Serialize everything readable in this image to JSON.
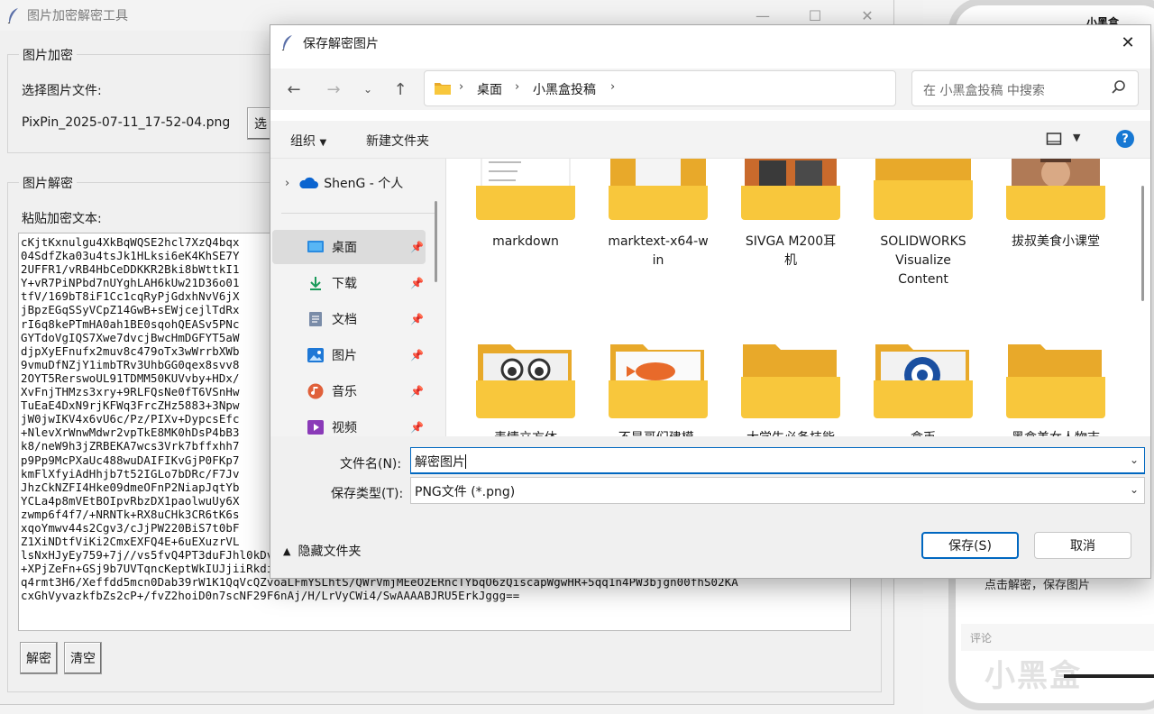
{
  "app": {
    "title": "图片加密解密工具",
    "encrypt_group": "图片加密",
    "choose_file_label": "选择图片文件:",
    "file_name": "PixPin_2025-07-11_17-52-04.png",
    "choose_button": "选",
    "decrypt_group": "图片解密",
    "paste_label": "粘贴加密文本:",
    "cipher_lines": [
      "cKjtKxnulgu4XkBqWQSE2hcl7XzQ4bqx",
      "04SdfZka03u4tsJk1HLksi6eK4KhSE7Y",
      "2UFFR1/vRB4HbCeDDKKR2Bki8bWttkI1",
      "Y+vR7PiNPbd7nUYghLAH6kUw21D36o01",
      "tfV/169bT8iF1Cc1cqRyPjGdxhNvV6jX",
      "jBpzEGqSSyVCpZ14GwB+sEWjcejlTdRx",
      "rI6q8kePTmHA0ah1BE0sqohQEASv5PNc",
      "GYTdoVgIQS7Xwe7dvcjBwcHmDGFYT5aW",
      "djpXyEFnufx2muv8c479oTx3wWrrbXWb",
      "9vmuDfNZjY1imbTRv3UhbGG0qex8svv8",
      "2OYT5RerswoUL91TDMM50KUVvby+HDx/",
      "XvFnjTHMzs3xry+9RLFQsNe0fT6VSnHw",
      "TuEaE4DxN9rjKFWq3FrcZHz5883+3Npw",
      "jW0jwIKV4x6vU6c/Pz/PIXv+DypcsEfc",
      "+NlevXrWnwMdwr2vpTkE8MK0hDsP4bB3",
      "k8/neW9h3jZRBEKA7wcs3Vrk7bffxhh7",
      "p9Pp9McPXaUc488wuDAIFIKvGjP0FKp7",
      "kmFlXfyiAdHhjb7t52IGLo7bDRc/F7Jv",
      "JhzCkNZFI4Hke09dmeOFnP2NiapJqtYb",
      "YCLa4p8mVEtBOIpvRbzDX1paolwuUy6X",
      "zwmp6f4f7/+NRNTk+RX8uCHk3CR6tK6s",
      "xqoYmwv44s2Cgv3/cJjPW220BiS7t0bF",
      "Z1XiNDtfViKi2CmxEXFQ4E+6uEXuzrVL",
      "lsNxHJyEy759+7j//vs5fvQ4PT3duFJhl0kDvnkEzwlOSOVjHhnClWqSyC+CKHh3jdwEmpniVBC6SLLNK5fzzaNjVzOi7yrjq+OCSLEhw",
      "+XPjZeFn+GSj9b7UVTqncKeptWkIUJjiiRkdiTEuOfF/ta2hHYtZjWaBWhEM8WecxMufX19HDx4kAfPPMjYqN2YIqjXLb/WUbnrCieC67",
      "q4rmt3H6/Xeffdd5mcn0Dab39rW1K1QqVcQZvoaLFmYSLhtS/QWrVmjMEeO2ERncTYbqO6zQiscapWgwHR+5qq1n4PW3bjgn00fhS02KA",
      "cxGhVyvazkfbZs2cP+/fvZ2hoiD0n7scNF29F6nAj/H/LrVyCWi4/SwAAAABJRU5ErkJggg=="
    ],
    "decrypt_button": "解密",
    "clear_button": "清空"
  },
  "background_app": {
    "logo_text": "小黑盒",
    "text_line": "点击解密，保存图片",
    "comment_placeholder": "评论",
    "watermark": "小黑盒"
  },
  "dialog": {
    "title": "保存解密图片",
    "breadcrumbs": [
      "桌面",
      "小黑盒投稿"
    ],
    "search_placeholder": "在 小黑盒投稿 中搜索",
    "organize_label": "组织",
    "new_folder_label": "新建文件夹",
    "help_label": "?",
    "nav": {
      "onedrive": "ShenG - 个人",
      "items": [
        {
          "label": "桌面",
          "icon": "desktop-icon",
          "selected": true
        },
        {
          "label": "下载",
          "icon": "download-icon",
          "selected": false
        },
        {
          "label": "文档",
          "icon": "document-icon",
          "selected": false
        },
        {
          "label": "图片",
          "icon": "pictures-icon",
          "selected": false
        },
        {
          "label": "音乐",
          "icon": "music-icon",
          "selected": false
        },
        {
          "label": "视频",
          "icon": "video-icon",
          "selected": false
        }
      ]
    },
    "folders_row1": [
      {
        "line1": "markdown",
        "line2": "",
        "line3": ""
      },
      {
        "line1": "marktext-x64-w",
        "line2": "in",
        "line3": ""
      },
      {
        "line1": "SIVGA M200耳",
        "line2": "机",
        "line3": ""
      },
      {
        "line1": "SOLIDWORKS",
        "line2": "Visualize",
        "line3": "Content"
      },
      {
        "line1": "拔叔美食小课堂",
        "line2": "",
        "line3": ""
      }
    ],
    "folders_row2": [
      "表情立方体",
      "不是哥们建模·",
      "大学生必备技能",
      "盒币",
      "黑盒美女人物志"
    ],
    "filename_label": "文件名(N):",
    "filename_value": "解密图片",
    "filetype_label": "保存类型(T):",
    "filetype_value": "PNG文件 (*.png)",
    "hide_folders_label": "隐藏文件夹",
    "save_button": "保存(S)",
    "cancel_button": "取消"
  }
}
